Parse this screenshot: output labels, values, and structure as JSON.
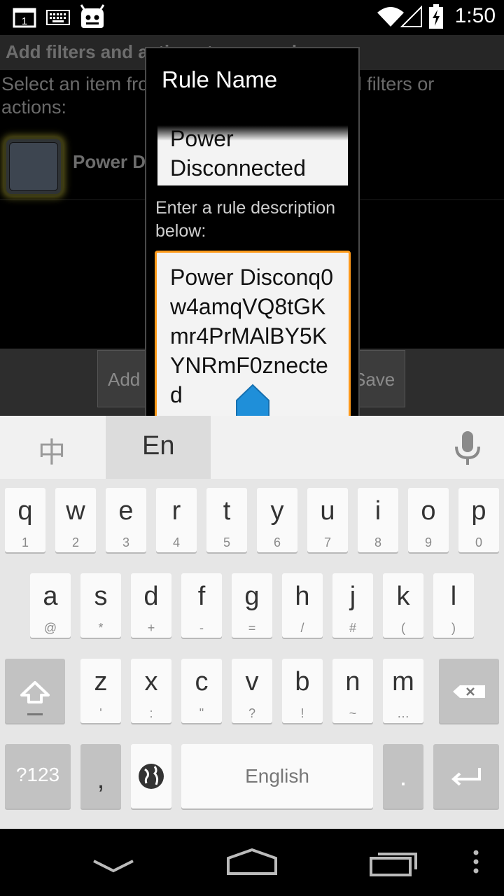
{
  "status_bar": {
    "time": "1:50",
    "notification_badge": "1",
    "icons": [
      "notification-1-icon",
      "keyboard-icon",
      "cyanogenmod-icon",
      "wifi-icon",
      "signal-icon",
      "battery-charging-icon"
    ]
  },
  "background_app": {
    "title": "Add filters and actions to your rule",
    "description": "Select an item from the list below, then add filters or actions:",
    "item_label": "Power Disconnected",
    "buttons": [
      "Add",
      "Save"
    ]
  },
  "dialog": {
    "title": "Rule Name",
    "name_value": "Power\nDisconnected",
    "description_label": "Enter a rule description below:",
    "description_value": "Power Disconq0w4amqVQ8tGKmr4PrMAlBY5KYNRmF0znected"
  },
  "keyboard": {
    "lang_tabs": [
      "中",
      "En"
    ],
    "rows": [
      [
        {
          "main": "q",
          "sub": "1"
        },
        {
          "main": "w",
          "sub": "2"
        },
        {
          "main": "e",
          "sub": "3"
        },
        {
          "main": "r",
          "sub": "4"
        },
        {
          "main": "t",
          "sub": "5"
        },
        {
          "main": "y",
          "sub": "6"
        },
        {
          "main": "u",
          "sub": "7"
        },
        {
          "main": "i",
          "sub": "8"
        },
        {
          "main": "o",
          "sub": "9"
        },
        {
          "main": "p",
          "sub": "0"
        }
      ],
      [
        {
          "main": "a",
          "sub": "@"
        },
        {
          "main": "s",
          "sub": "*"
        },
        {
          "main": "d",
          "sub": "+"
        },
        {
          "main": "f",
          "sub": "-"
        },
        {
          "main": "g",
          "sub": "="
        },
        {
          "main": "h",
          "sub": "/"
        },
        {
          "main": "j",
          "sub": "#"
        },
        {
          "main": "k",
          "sub": "("
        },
        {
          "main": "l",
          "sub": ")"
        }
      ],
      [
        {
          "main": "z",
          "sub": "'"
        },
        {
          "main": "x",
          "sub": ":"
        },
        {
          "main": "c",
          "sub": "\""
        },
        {
          "main": "v",
          "sub": "?"
        },
        {
          "main": "b",
          "sub": "!"
        },
        {
          "main": "n",
          "sub": "~"
        },
        {
          "main": "m",
          "sub": "…"
        }
      ]
    ],
    "symbols_label": "?123",
    "comma_label": ",",
    "space_label": "English",
    "period_label": "."
  },
  "nav_bar": {
    "icons": [
      "back-icon",
      "home-icon",
      "recents-icon",
      "menu-icon"
    ]
  }
}
